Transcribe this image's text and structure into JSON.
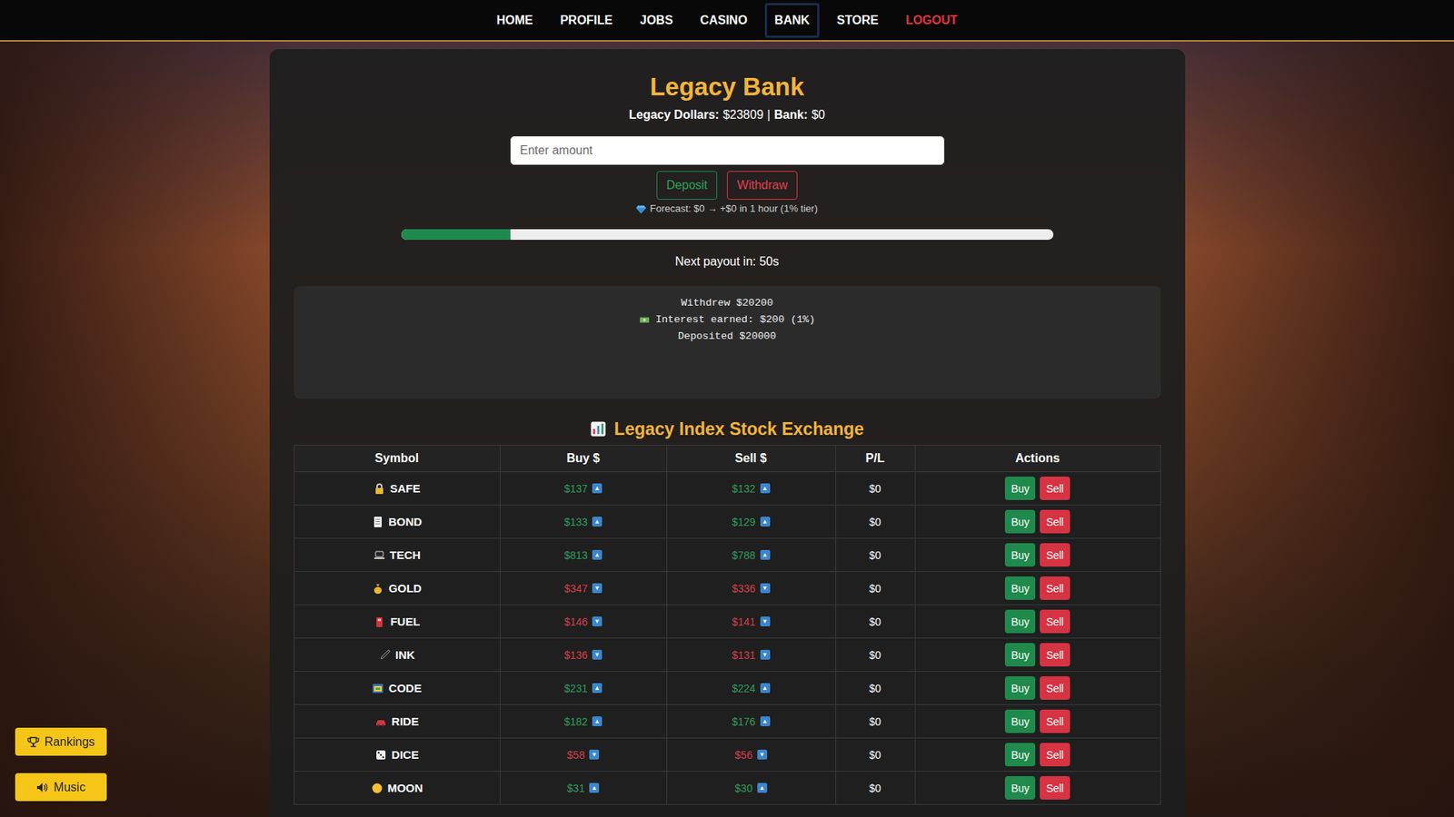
{
  "nav": {
    "items": [
      {
        "label": "HOME",
        "selected": false,
        "kind": "normal"
      },
      {
        "label": "PROFILE",
        "selected": false,
        "kind": "normal"
      },
      {
        "label": "JOBS",
        "selected": false,
        "kind": "normal"
      },
      {
        "label": "CASINO",
        "selected": false,
        "kind": "normal"
      },
      {
        "label": "BANK",
        "selected": true,
        "kind": "normal"
      },
      {
        "label": "STORE",
        "selected": false,
        "kind": "normal"
      },
      {
        "label": "LOGOUT",
        "selected": false,
        "kind": "danger"
      }
    ]
  },
  "bank": {
    "title": "Legacy Bank",
    "stats": [
      {
        "label": "Legacy Dollars:",
        "value": "$23809"
      },
      {
        "label": "Bank:",
        "value": "$0"
      }
    ],
    "stats_separator": "|",
    "amount_input": {
      "placeholder": "Enter amount",
      "value": ""
    },
    "buttons": [
      {
        "label": "Deposit",
        "kind": "deposit"
      },
      {
        "label": "Withdraw",
        "kind": "withdraw"
      }
    ],
    "forecast": "Forecast: $0 → +$0 in 1 hour (1% tier)",
    "payout": {
      "level": 0.168,
      "label": "Next payout in: 50s"
    },
    "log": [
      {
        "text": "Withdrew $20200",
        "icon": false
      },
      {
        "text": "Interest earned: $200 (1%)",
        "icon": true
      },
      {
        "text": "Deposited $20000",
        "icon": false
      }
    ]
  },
  "exchange": {
    "title": "Legacy Index Stock Exchange",
    "columns": [
      "Symbol",
      "Buy $",
      "Sell $",
      "P/L",
      "Actions"
    ],
    "rows": [
      {
        "symbol": "SAFE",
        "buy": "$137",
        "sell": "$132",
        "trend": "up",
        "arrow": "▲",
        "pl": "$0",
        "actions": [
          "Buy",
          "Sell"
        ]
      },
      {
        "symbol": "BOND",
        "buy": "$133",
        "sell": "$129",
        "trend": "up",
        "arrow": "▲",
        "pl": "$0",
        "actions": [
          "Buy",
          "Sell"
        ]
      },
      {
        "symbol": "TECH",
        "buy": "$813",
        "sell": "$788",
        "trend": "up",
        "arrow": "▲",
        "pl": "$0",
        "actions": [
          "Buy",
          "Sell"
        ]
      },
      {
        "symbol": "GOLD",
        "buy": "$347",
        "sell": "$336",
        "trend": "down",
        "arrow": "▼",
        "pl": "$0",
        "actions": [
          "Buy",
          "Sell"
        ]
      },
      {
        "symbol": "FUEL",
        "buy": "$146",
        "sell": "$141",
        "trend": "down",
        "arrow": "▼",
        "pl": "$0",
        "actions": [
          "Buy",
          "Sell"
        ]
      },
      {
        "symbol": "INK",
        "buy": "$136",
        "sell": "$131",
        "trend": "down",
        "arrow": "▼",
        "pl": "$0",
        "actions": [
          "Buy",
          "Sell"
        ]
      },
      {
        "symbol": "CODE",
        "buy": "$231",
        "sell": "$224",
        "trend": "up",
        "arrow": "▲",
        "pl": "$0",
        "actions": [
          "Buy",
          "Sell"
        ]
      },
      {
        "symbol": "RIDE",
        "buy": "$182",
        "sell": "$176",
        "trend": "up",
        "arrow": "▲",
        "pl": "$0",
        "actions": [
          "Buy",
          "Sell"
        ]
      },
      {
        "symbol": "DICE",
        "buy": "$58",
        "sell": "$56",
        "trend": "down",
        "arrow": "▼",
        "pl": "$0",
        "actions": [
          "Buy",
          "Sell"
        ]
      },
      {
        "symbol": "MOON",
        "buy": "$31",
        "sell": "$30",
        "trend": "up",
        "arrow": "▲",
        "pl": "$0",
        "actions": [
          "Buy",
          "Sell"
        ]
      }
    ]
  },
  "floating_buttons": [
    {
      "label": "Rankings"
    },
    {
      "label": "Music"
    }
  ]
}
